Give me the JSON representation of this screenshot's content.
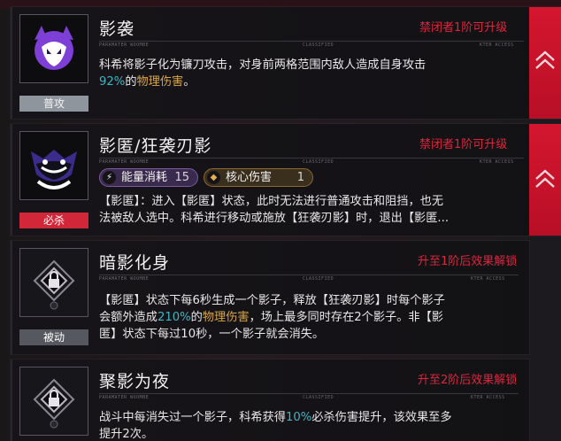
{
  "skills": [
    {
      "name": "影袭",
      "type_tag": "普攻",
      "unlock": "禁闭者1阶可升级",
      "micro_left": "PARAMATER WOOMBE",
      "micro_mid": "CLASSIFIED",
      "micro_right": "KTER ACCESS",
      "desc_1": "科希将影子化为镰刀攻击，对身前两格范围内敌人造成自身攻击",
      "desc_2_pct": "92%",
      "desc_2_mid": "的",
      "desc_2_kw": "物理伤害",
      "desc_2_end": "。",
      "icon": "demon-cat-icon",
      "upgrade_icon": "chevron-up-icon"
    },
    {
      "name": "影匿/狂袭刃影",
      "type_tag": "必杀",
      "unlock": "禁闭者1阶可升级",
      "micro_left": "PARAMATER WOOMBE",
      "micro_mid": "CLASSIFIED",
      "micro_right": "KTER ACCESS",
      "energy_label": "能量消耗",
      "energy_value": "15",
      "core_label": "核心伤害",
      "core_value": "1",
      "desc_1": "【影匿】：进入【影匿】状态，此时无法进行普通攻击和阻挡，也无",
      "desc_2": "法被敌人选中。科希进行移动或施放【狂袭刃影】时，退出【影匿...",
      "icon": "grinning-shadow-icon",
      "upgrade_icon": "chevron-up-icon"
    },
    {
      "name": "暗影化身",
      "type_tag": "被动",
      "unlock": "升至1阶后效果解锁",
      "micro_left": "PARAMATER WOOMBE",
      "micro_mid": "CLASSIFIED",
      "micro_right": "KTER ACCESS",
      "desc_1": "【影匿】状态下每6秒生成一个影子，释放【狂袭刃影】时每个影子",
      "desc_2_start": "会额外造成",
      "desc_2_pct": "210%",
      "desc_2_mid": "的",
      "desc_2_kw": "物理伤害",
      "desc_2_end": "，场上最多同时存在2个影子。非【影",
      "desc_3": "匿】状态下每过10秒，一个影子就会消失。",
      "icon": "lock-emblem-icon"
    },
    {
      "name": "聚影为夜",
      "unlock": "升至2阶后效果解锁",
      "micro_left": "PARAMATER WOOMBE",
      "micro_mid": "CLASSIFIED",
      "micro_right": "KTER ACCESS",
      "desc_1_start": "战斗中每消失过一个影子，科希获得",
      "desc_1_pct": "10%",
      "desc_1_end": "必杀伤害提升，该效果至多",
      "desc_2": "提升2次。",
      "icon": "lock-emblem-icon"
    }
  ],
  "colors": {
    "accent_red": "#e0243d",
    "teal": "#3fb6c3",
    "gold": "#d6a649"
  }
}
